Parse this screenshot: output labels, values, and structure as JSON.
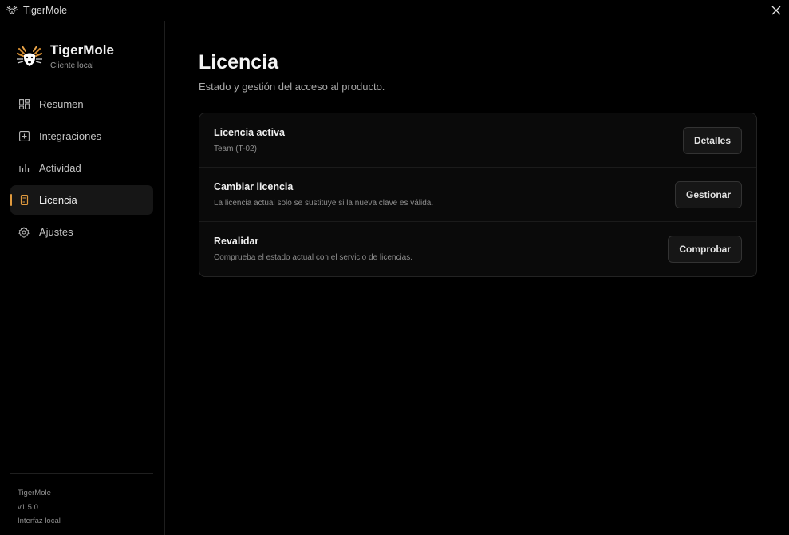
{
  "window": {
    "title": "TigerMole",
    "app_icon": "tiger-mole-icon",
    "close_icon": "close-icon"
  },
  "sidebar": {
    "brand": {
      "name": "TigerMole",
      "subtitle": "Cliente local",
      "logo_icon": "tiger-mole-logo"
    },
    "items": [
      {
        "label": "Resumen",
        "icon": "dashboard-icon",
        "active": false
      },
      {
        "label": "Integraciones",
        "icon": "plus-square-icon",
        "active": false
      },
      {
        "label": "Actividad",
        "icon": "bar-chart-icon",
        "active": false
      },
      {
        "label": "Licencia",
        "icon": "license-icon",
        "active": true
      },
      {
        "label": "Ajustes",
        "icon": "gear-icon",
        "active": false
      }
    ],
    "footer": {
      "name": "TigerMole",
      "version": "v1.5.0",
      "mode": "Interfaz local"
    }
  },
  "main": {
    "title": "Licencia",
    "subtitle": "Estado y gestión del acceso al producto.",
    "rows": [
      {
        "title": "Licencia activa",
        "description": "Team (T-02)",
        "button": "Detalles"
      },
      {
        "title": "Cambiar licencia",
        "description": "La licencia actual solo se sustituye si la nueva clave es válida.",
        "button": "Gestionar"
      },
      {
        "title": "Revalidar",
        "description": "Comprueba el estado actual con el servicio de licencias.",
        "button": "Comprobar"
      }
    ]
  },
  "colors": {
    "accent": "#e09a3e",
    "background": "#000000",
    "card": "#0a0a0a"
  }
}
